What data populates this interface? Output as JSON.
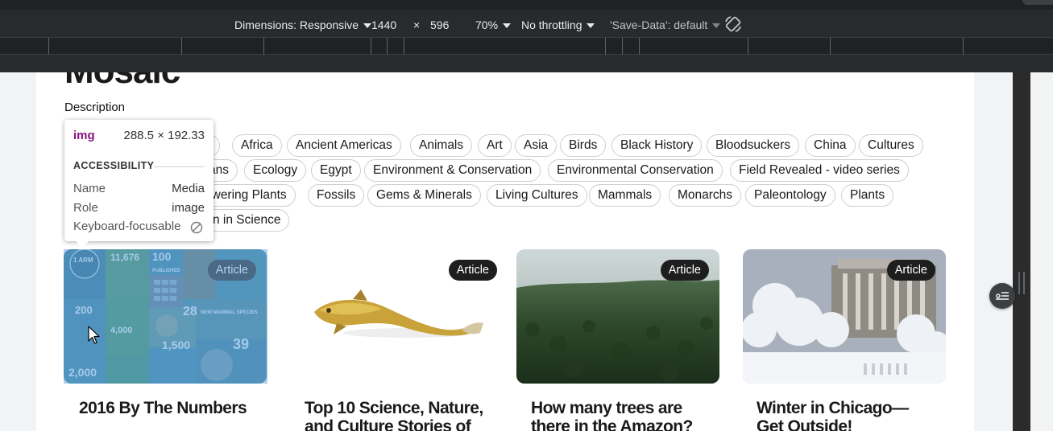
{
  "devtools": {
    "dimensions_label": "Dimensions: Responsive",
    "width": "1440",
    "times": "×",
    "height": "596",
    "zoom": "70%",
    "throttling": "No throttling",
    "save_data": "'Save-Data': default",
    "rotate_icon": "rotate-icon"
  },
  "page": {
    "title": "Mosaic",
    "description_label": "Description",
    "tags": [
      "y",
      "Africa",
      "Ancient Americas",
      "Animals",
      "Art",
      "Asia",
      "Birds",
      "Black History",
      "Bloodsuckers",
      "China",
      "Cultures",
      "ans",
      "Ecology",
      "Egypt",
      "Environment & Conservation",
      "Environmental Conservation",
      "Field Revealed - video series",
      "owering Plants",
      "Fossils",
      "Gems & Minerals",
      "Living Cultures",
      "Mammals",
      "Monarchs",
      "Paleontology",
      "Plants",
      "n in Science"
    ],
    "cards": [
      {
        "badge": "Article",
        "title_l1": "2016 By The Numbers",
        "title_l2": ""
      },
      {
        "badge": "Article",
        "title_l1": "Top 10 Science, Nature,",
        "title_l2": "and Culture Stories of"
      },
      {
        "badge": "Article",
        "title_l1": "How many trees are",
        "title_l2": "there in the Amazon?"
      },
      {
        "badge": "Article",
        "title_l1": "Winter in Chicago—",
        "title_l2": "Get Outside!"
      }
    ],
    "infographic_texts": [
      "1 ARM",
      "11,676",
      "100",
      "PUBLISHED",
      "200",
      "28",
      "NEW MAMMAL SPECIES",
      "4,000",
      "1,500",
      "39",
      "2,000"
    ]
  },
  "inspect_tooltip": {
    "tag": "img",
    "dimensions": "288.5 × 192.33",
    "section": "ACCESSIBILITY",
    "name_key": "Name",
    "name_val": "Media",
    "role_key": "Role",
    "role_val": "image",
    "kb_key": "Keyboard-focusable",
    "kb_icon": "no-entry-icon"
  },
  "colors": {
    "toolbar_bg": "#292a2d",
    "highlight": "#6fa8dc",
    "tag_purple": "#881280"
  }
}
